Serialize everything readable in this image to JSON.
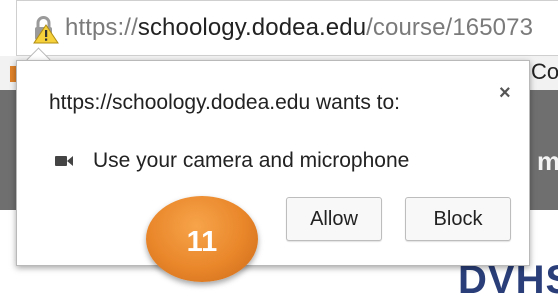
{
  "browser": {
    "url_scheme": "https://",
    "url_domain": "schoology.dodea.edu",
    "url_path": "/course/165073"
  },
  "background": {
    "partial_text_top": "Co",
    "partial_text_mid": "m",
    "partial_text_bottom": "DVHS"
  },
  "permission_prompt": {
    "title": "https://schoology.dodea.edu wants to:",
    "close_label": "×",
    "request_icon": "camera-icon",
    "request_text": "Use your camera and microphone",
    "allow_label": "Allow",
    "block_label": "Block"
  },
  "step_badge": {
    "number": "11",
    "color": "#e9862a"
  }
}
